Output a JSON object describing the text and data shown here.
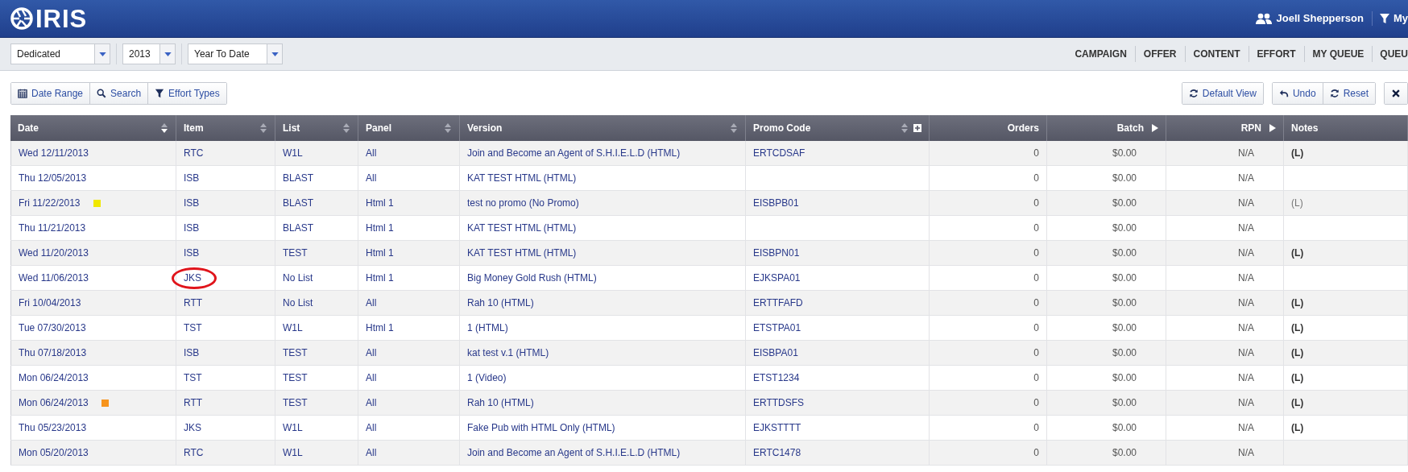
{
  "app_bar": {
    "logo_text": "IRIS",
    "user": "Joell Shepperson",
    "filter_label": "My"
  },
  "filters": [
    {
      "value": "Dedicated"
    },
    {
      "value": "2013"
    },
    {
      "value": "Year To Date"
    }
  ],
  "nav": [
    "CAMPAIGN",
    "OFFER",
    "CONTENT",
    "EFFORT",
    "MY QUEUE",
    "QUEU"
  ],
  "toolbar_left": [
    {
      "kind": "calendar",
      "label": "Date Range"
    },
    {
      "kind": "search",
      "label": "Search"
    },
    {
      "kind": "filter",
      "label": "Effort Types"
    }
  ],
  "toolbar_right": [
    [
      {
        "kind": "refresh",
        "label": "Default View"
      }
    ],
    [
      {
        "kind": "undo",
        "label": "Undo"
      },
      {
        "kind": "refresh",
        "label": "Reset"
      }
    ],
    [
      {
        "kind": "close"
      }
    ]
  ],
  "table": {
    "columns": [
      {
        "label": "Date",
        "kind": "sortable",
        "sorted": true
      },
      {
        "label": "Item",
        "kind": "sortable",
        "sorted": false
      },
      {
        "label": "List",
        "kind": "sortable",
        "sorted": false
      },
      {
        "label": "Panel",
        "kind": "sortable",
        "sorted": false
      },
      {
        "label": "Version",
        "kind": "sortable",
        "sorted": false
      },
      {
        "label": "Promo Code",
        "kind": "sortable-add",
        "sorted": false
      },
      {
        "label": "Orders",
        "kind": "plain"
      },
      {
        "label": "Batch",
        "kind": "expandable"
      },
      {
        "label": "RPN",
        "kind": "expandable"
      },
      {
        "label": "Notes",
        "kind": "plain"
      }
    ],
    "rows": [
      {
        "date": "Wed 12/11/2013",
        "item": "RTC",
        "circled": false,
        "list": "W1L",
        "panel": "All",
        "version": "Join and Become an Agent of S.H.I.E.L.D (HTML)",
        "promo_code": "ERTCDSAF",
        "orders": "0",
        "batch": "$0.00",
        "rpn": "N/A",
        "notes": "(L)",
        "notes_bold": true
      },
      {
        "date": "Thu 12/05/2013",
        "item": "ISB",
        "circled": false,
        "list": "BLAST",
        "panel": "All",
        "version": "KAT TEST HTML (HTML)",
        "orders": "0",
        "batch": "$0.00",
        "rpn": "N/A"
      },
      {
        "date": "Fri 11/22/2013",
        "color": "#f0e800",
        "item": "ISB",
        "circled": false,
        "list": "BLAST",
        "panel": "Html 1",
        "version": "test no promo (No Promo)",
        "promo_code": "EISBPB01",
        "orders": "0",
        "batch": "$0.00",
        "rpn": "N/A",
        "notes": "(L)",
        "notes_bold": false
      },
      {
        "date": "Thu 11/21/2013",
        "item": "ISB",
        "circled": false,
        "list": "BLAST",
        "panel": "Html 1",
        "version": "KAT TEST HTML (HTML)",
        "orders": "0",
        "batch": "$0.00",
        "rpn": "N/A"
      },
      {
        "date": "Wed 11/20/2013",
        "item": "ISB",
        "circled": false,
        "list": "TEST",
        "panel": "Html 1",
        "version": "KAT TEST HTML (HTML)",
        "promo_code": "EISBPN01",
        "orders": "0",
        "batch": "$0.00",
        "rpn": "N/A",
        "notes": "(L)",
        "notes_bold": true
      },
      {
        "date": "Wed 11/06/2013",
        "item": "JKS",
        "circled": true,
        "list": "No List",
        "panel": "Html 1",
        "version": "Big Money Gold Rush (HTML)",
        "promo_code": "EJKSPA01",
        "orders": "0",
        "batch": "$0.00",
        "rpn": "N/A"
      },
      {
        "date": "Fri 10/04/2013",
        "item": "RTT",
        "circled": false,
        "list": "No List",
        "panel": "All",
        "version": "Rah 10 (HTML)",
        "promo_code": "ERTTFAFD",
        "orders": "0",
        "batch": "$0.00",
        "rpn": "N/A",
        "notes": "(L)",
        "notes_bold": true
      },
      {
        "date": "Tue 07/30/2013",
        "item": "TST",
        "circled": false,
        "list": "W1L",
        "panel": "Html 1",
        "version": "1 (HTML)",
        "promo_code": "ETSTPA01",
        "orders": "0",
        "batch": "$0.00",
        "rpn": "N/A",
        "notes": "(L)",
        "notes_bold": true
      },
      {
        "date": "Thu 07/18/2013",
        "item": "ISB",
        "circled": false,
        "list": "TEST",
        "panel": "All",
        "version": "kat test v.1 (HTML)",
        "promo_code": "EISBPA01",
        "orders": "0",
        "batch": "$0.00",
        "rpn": "N/A",
        "notes": "(L)",
        "notes_bold": true
      },
      {
        "date": "Mon 06/24/2013",
        "item": "TST",
        "circled": false,
        "list": "TEST",
        "panel": "All",
        "version": "1 (Video)",
        "promo_code": "ETST1234",
        "orders": "0",
        "batch": "$0.00",
        "rpn": "N/A",
        "notes": "(L)",
        "notes_bold": true
      },
      {
        "date": "Mon 06/24/2013",
        "color": "#f7941d",
        "item": "RTT",
        "circled": false,
        "list": "TEST",
        "panel": "All",
        "version": "Rah 10 (HTML)",
        "promo_code": "ERTTDSFS",
        "orders": "0",
        "batch": "$0.00",
        "rpn": "N/A",
        "notes": "(L)",
        "notes_bold": true
      },
      {
        "date": "Thu 05/23/2013",
        "item": "JKS",
        "circled": false,
        "list": "W1L",
        "panel": "All",
        "version": "Fake Pub with HTML Only (HTML)",
        "promo_code": "EJKSTTTT",
        "orders": "0",
        "batch": "$0.00",
        "rpn": "N/A",
        "notes": "(L)",
        "notes_bold": true
      },
      {
        "date": "Mon 05/20/2013",
        "item": "RTC",
        "circled": false,
        "list": "W1L",
        "panel": "All",
        "version": "Join and Become an Agent of S.H.I.E.L.D (HTML)",
        "promo_code": "ERTC1478",
        "orders": "0",
        "batch": "$0.00",
        "rpn": "N/A"
      }
    ]
  }
}
